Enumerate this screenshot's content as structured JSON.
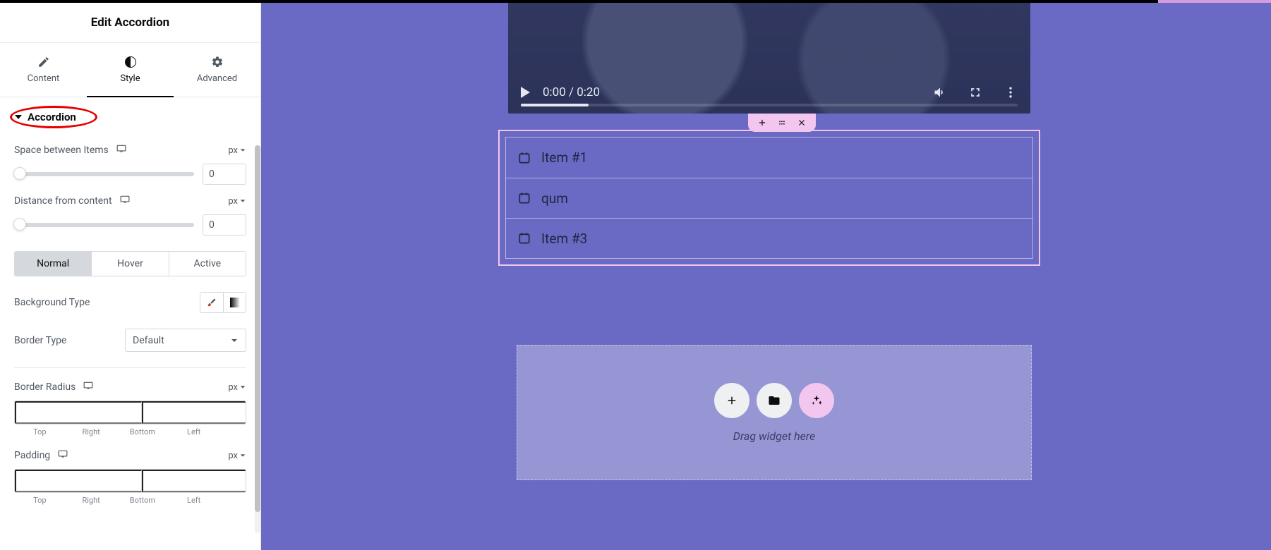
{
  "panel": {
    "title": "Edit Accordion",
    "tabs": {
      "content": "Content",
      "style": "Style",
      "advanced": "Advanced"
    },
    "section": "Accordion",
    "space_between_label": "Space between Items",
    "space_between_unit": "px",
    "space_between_value": "0",
    "distance_label": "Distance from content",
    "distance_unit": "px",
    "distance_value": "0",
    "states": {
      "normal": "Normal",
      "hover": "Hover",
      "active": "Active"
    },
    "bg_type_label": "Background Type",
    "border_type_label": "Border Type",
    "border_type_value": "Default",
    "border_radius_label": "Border Radius",
    "border_radius_unit": "px",
    "padding_label": "Padding",
    "padding_unit": "px",
    "dim_labels": {
      "top": "Top",
      "right": "Right",
      "bottom": "Bottom",
      "left": "Left"
    }
  },
  "canvas": {
    "video_time": "0:00 / 0:20",
    "accordion_items": [
      "Item #1",
      "qum",
      "Item #3"
    ],
    "dropzone_text": "Drag widget here"
  }
}
